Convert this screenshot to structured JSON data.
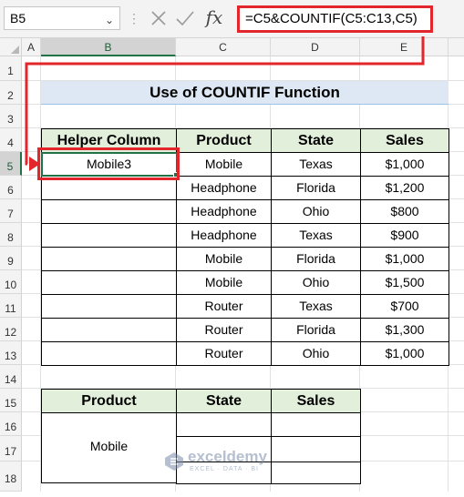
{
  "formula_bar": {
    "name_box": "B5",
    "formula": "=C5&COUNTIF(C5:C13,C5)",
    "dropdown_icon": "chevron-down-icon",
    "cancel_icon": "close-icon",
    "enter_icon": "checkmark-icon",
    "fx_label": "fx"
  },
  "columns": [
    "A",
    "B",
    "C",
    "D",
    "E"
  ],
  "rows": [
    "1",
    "2",
    "3",
    "4",
    "5",
    "6",
    "7",
    "8",
    "9",
    "10",
    "11",
    "12",
    "13",
    "14",
    "15",
    "16",
    "17",
    "18"
  ],
  "selected": {
    "column": "B",
    "row": "5"
  },
  "title": "Use of COUNTIF Function",
  "main_table": {
    "headers": [
      "Helper Column",
      "Product",
      "State",
      "Sales"
    ],
    "rows": [
      [
        "Mobile3",
        "Mobile",
        "Texas",
        "$1,000"
      ],
      [
        "",
        "Headphone",
        "Florida",
        "$1,200"
      ],
      [
        "",
        "Headphone",
        "Ohio",
        "$800"
      ],
      [
        "",
        "Headphone",
        "Texas",
        "$900"
      ],
      [
        "",
        "Mobile",
        "Florida",
        "$1,000"
      ],
      [
        "",
        "Mobile",
        "Ohio",
        "$1,500"
      ],
      [
        "",
        "Router",
        "Texas",
        "$700"
      ],
      [
        "",
        "Router",
        "Florida",
        "$1,300"
      ],
      [
        "",
        "Router",
        "Ohio",
        "$1,000"
      ]
    ]
  },
  "lookup_table": {
    "headers": [
      "Product",
      "State",
      "Sales"
    ],
    "product_value": "Mobile"
  },
  "watermark": {
    "name": "exceldemy",
    "tagline": "EXCEL · DATA · BI"
  },
  "colors": {
    "accent_red": "#e3262b",
    "header_green": "#e2efda",
    "title_blue": "#dde8f4",
    "excel_green": "#217346"
  }
}
